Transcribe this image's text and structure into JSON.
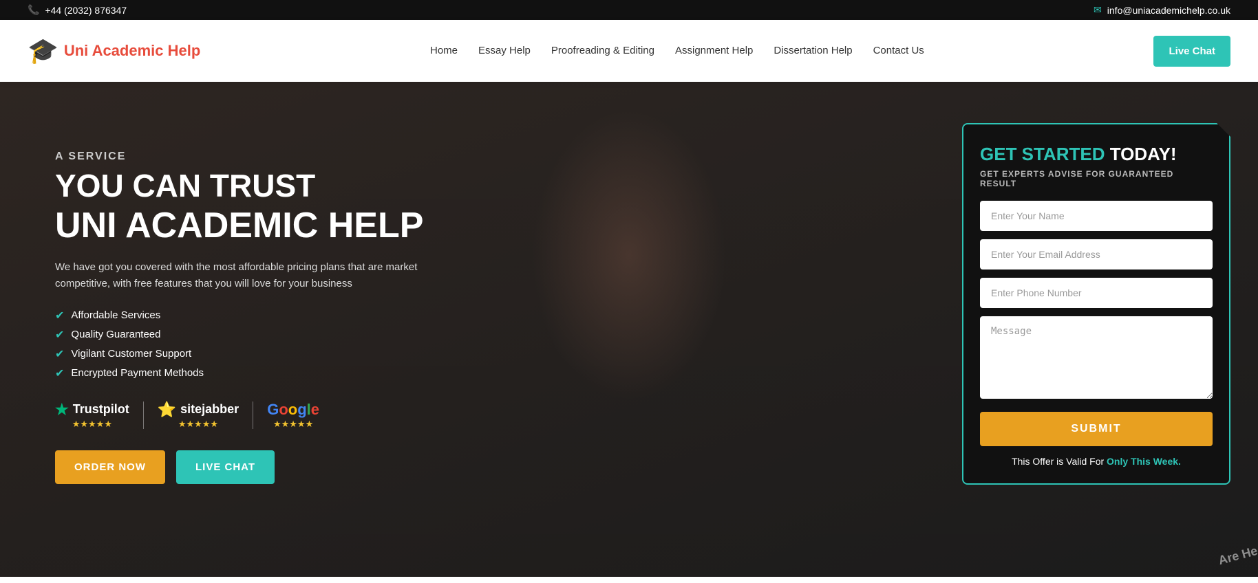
{
  "topbar": {
    "phone": "+44 (2032) 876347",
    "email": "info@uniacademichelp.co.uk",
    "phone_icon": "📞",
    "email_icon": "✉"
  },
  "navbar": {
    "logo_text": "Uni Academic Help",
    "nav_links": [
      {
        "label": "Home",
        "href": "#"
      },
      {
        "label": "Essay Help",
        "href": "#"
      },
      {
        "label": "Proofreading & Editing",
        "href": "#"
      },
      {
        "label": "Assignment Help",
        "href": "#"
      },
      {
        "label": "Dissertation Help",
        "href": "#"
      },
      {
        "label": "Contact Us",
        "href": "#"
      }
    ],
    "live_chat_label": "Live Chat"
  },
  "hero": {
    "a_service": "A SERVICE",
    "you_can_trust": "YOU CAN TRUST",
    "brand_name": "UNI ACADEMIC HELP",
    "description": "We have got you covered with the most affordable pricing plans that are market competitive, with free features that you will love for your business",
    "features": [
      "Affordable Services",
      "Quality Guaranteed",
      "Vigilant Customer Support",
      "Encrypted Payment Methods"
    ],
    "reviews": [
      {
        "name": "Trustpilot",
        "stars": "★★★★★"
      },
      {
        "name": "sitejabber",
        "stars": "★★★★★"
      },
      {
        "name": "Google",
        "stars": "★★★★★"
      }
    ],
    "btn_order": "ORDER NOW",
    "btn_livechat": "LIVE CHAT"
  },
  "form": {
    "title_green": "GET STARTED",
    "title_white": "TODAY!",
    "subtitle": "GET EXPERTS ADVISE FOR GUARANTEED RESULT",
    "name_placeholder": "Enter Your Name",
    "email_placeholder": "Enter Your Email Address",
    "phone_placeholder": "Enter Phone Number",
    "message_placeholder": "Message",
    "submit_label": "SUBMIT",
    "validity_text": "This Offer is Valid For",
    "validity_highlight": "Only This Week."
  }
}
